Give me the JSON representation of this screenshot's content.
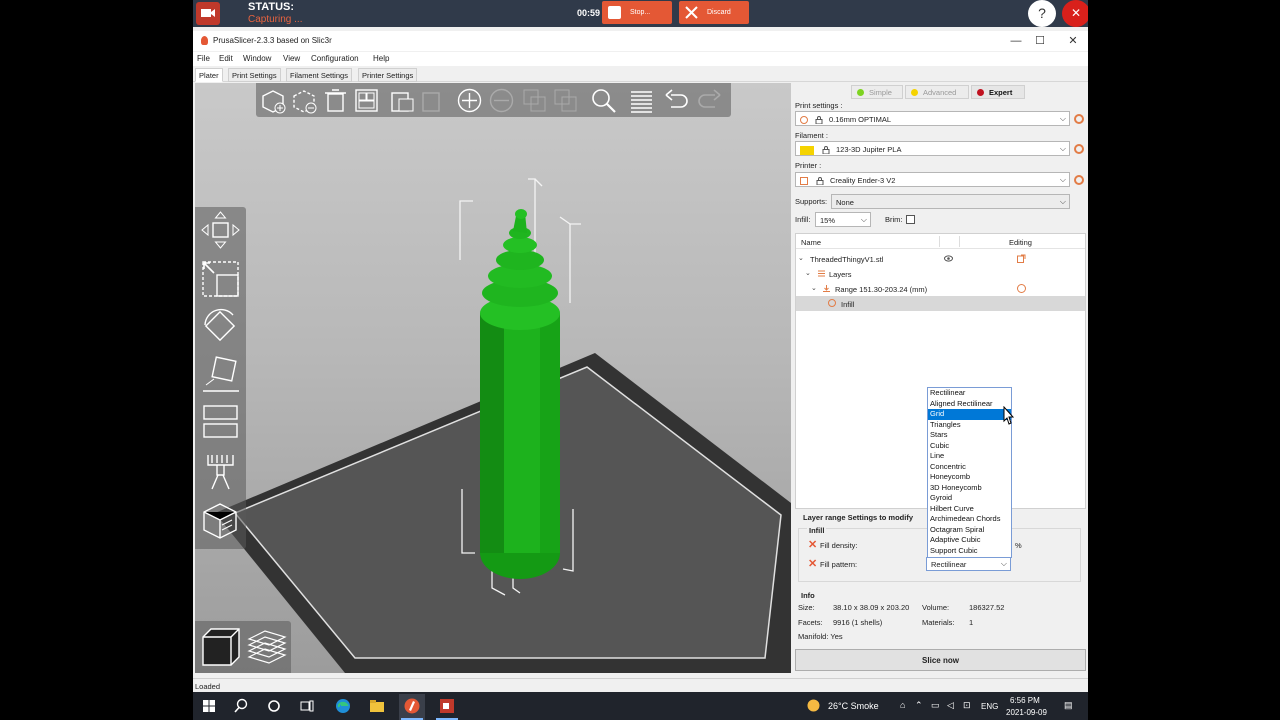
{
  "recorder": {
    "status_label": "STATUS:",
    "status_value": "Capturing ...",
    "timer": "00:59",
    "stop_label": "Stop...",
    "discard_label": "Discard",
    "help_label": "?",
    "close_label": "✕"
  },
  "window": {
    "title": "PrusaSlicer-2.3.3 based on Slic3r",
    "minimize": "—",
    "maximize": "☐",
    "close": "✕"
  },
  "menu": [
    "File",
    "Edit",
    "Window",
    "View",
    "Configuration",
    "Help"
  ],
  "tabs": [
    "Plater",
    "Print Settings",
    "Filament Settings",
    "Printer Settings"
  ],
  "modes": {
    "simple": "Simple",
    "advanced": "Advanced",
    "expert": "Expert",
    "colors": {
      "simple": "#7ed321",
      "advanced": "#f5d300",
      "expert": "#c0111f"
    }
  },
  "sidebar": {
    "print_settings_label": "Print settings :",
    "print_settings_value": "0.16mm OPTIMAL",
    "filament_label": "Filament :",
    "filament_value": "123-3D Jupiter PLA",
    "filament_color": "#f5d300",
    "printer_label": "Printer :",
    "printer_value": "Creality Ender-3 V2",
    "supports_label": "Supports:",
    "supports_value": "None",
    "infill_label": "Infill:",
    "infill_value": "15%",
    "brim_label": "Brim:"
  },
  "object_list": {
    "col_name": "Name",
    "col_editing": "Editing",
    "rows": [
      {
        "label": "ThreadedThingyV1.stl"
      },
      {
        "label": "Layers"
      },
      {
        "label": "Range 151.30-203.24 (mm)"
      },
      {
        "label": "Infill"
      }
    ]
  },
  "fill_pattern_options": [
    "Rectilinear",
    "Aligned Rectilinear",
    "Grid",
    "Triangles",
    "Stars",
    "Cubic",
    "Line",
    "Concentric",
    "Honeycomb",
    "3D Honeycomb",
    "Gyroid",
    "Hilbert Curve",
    "Archimedean Chords",
    "Octagram Spiral",
    "Adaptive Cubic",
    "Support Cubic"
  ],
  "fill_pattern_highlighted": "Grid",
  "layer_settings": {
    "title": "Layer range Settings to modify",
    "group": "Infill",
    "fill_density_label": "Fill density:",
    "fill_density_unit": "%",
    "fill_pattern_label": "Fill pattern:",
    "fill_pattern_value": "Rectilinear"
  },
  "info": {
    "title": "Info",
    "size_label": "Size:",
    "size_value": "38.10 x 38.09 x 203.20",
    "volume_label": "Volume:",
    "volume_value": "186327.52",
    "facets_label": "Facets:",
    "facets_value": "9916 (1 shells)",
    "materials_label": "Materials:",
    "materials_value": "1",
    "manifold_label": "Manifold: Yes"
  },
  "slice_button": "Slice now",
  "status_text": "Loaded",
  "taskbar": {
    "weather": "26°C  Smoke",
    "lang": "ENG",
    "time": "6:56 PM",
    "date": "2021-09-09"
  }
}
